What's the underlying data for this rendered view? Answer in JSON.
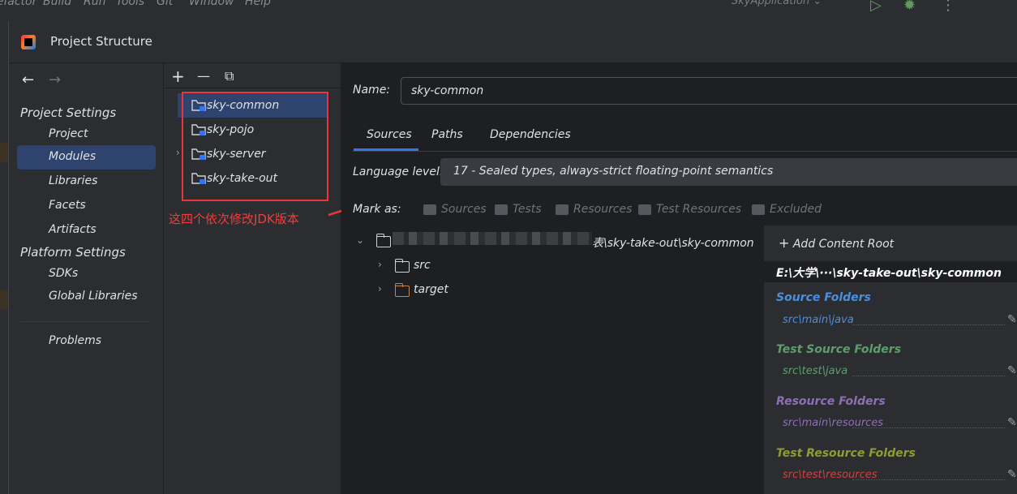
{
  "menubar": {
    "items": [
      "Refactor",
      "Build",
      "Run",
      "Tools",
      "Git",
      "Window",
      "Help"
    ],
    "run_config": "SkyApplication"
  },
  "dialog": {
    "title": "Project Structure"
  },
  "nav": {
    "back_label": "←",
    "forward_label": "→",
    "project_settings_header": "Project Settings",
    "project_settings_items": [
      "Project",
      "Modules",
      "Libraries",
      "Facets",
      "Artifacts"
    ],
    "platform_settings_header": "Platform Settings",
    "platform_settings_items": [
      "SDKs",
      "Global Libraries"
    ],
    "problems": "Problems",
    "selected": "Modules"
  },
  "modules": {
    "add_label": "+",
    "remove_label": "—",
    "copy_label": "⧉",
    "items": [
      "sky-common",
      "sky-pojo",
      "sky-server",
      "sky-take-out"
    ],
    "selected": "sky-common",
    "annotation": "这四个依次修改JDK版本"
  },
  "editor": {
    "name_label": "Name:",
    "name_value": "sky-common",
    "tabs": [
      "Sources",
      "Paths",
      "Dependencies"
    ],
    "active_tab": "Sources",
    "language_level_label": "Language level:",
    "language_level_value": "17 - Sealed types, always-strict floating-point semantics",
    "mark_as_label": "Mark as:",
    "mark_buttons": [
      "Sources",
      "Tests",
      "Resources",
      "Test Resources",
      "Excluded"
    ],
    "tree": {
      "root_suffix": "表\\sky-take-out\\sky-common",
      "children": [
        "src",
        "target"
      ]
    }
  },
  "content_roots": {
    "add_label": "Add Content Root",
    "root_path": "E:\\大学\\···\\sky-take-out\\sky-common",
    "groups": [
      {
        "title": "Source Folders",
        "path": "src\\main\\java",
        "title_color": "#4a8fe0",
        "path_color": "#4a8fe0"
      },
      {
        "title": "Test Source Folders",
        "path": "src\\test\\java",
        "title_color": "#5e9e6e",
        "path_color": "#5e9e6e"
      },
      {
        "title": "Resource Folders",
        "path": "src\\main\\resources",
        "title_color": "#8e6fb5",
        "path_color": "#8e6fb5"
      },
      {
        "title": "Test Resource Folders",
        "path": "src\\test\\resources",
        "title_color": "#8f9c32",
        "path_color": "#d0413f"
      }
    ]
  },
  "colors": {
    "accent": "#3574f0",
    "selection": "#2e436e",
    "annotation_red": "#e8363a"
  }
}
